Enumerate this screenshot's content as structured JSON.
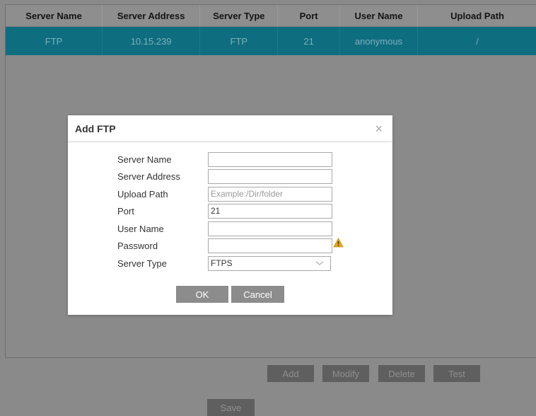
{
  "table": {
    "headers": [
      "Server Name",
      "Server Address",
      "Server Type",
      "Port",
      "User Name",
      "Upload Path"
    ],
    "rows": [
      [
        "FTP",
        "10.15.239",
        "FTP",
        "21",
        "anonymous",
        "/"
      ]
    ]
  },
  "actions": {
    "add": "Add",
    "modify": "Modify",
    "delete": "Delete",
    "test": "Test",
    "save": "Save"
  },
  "dialog": {
    "title": "Add FTP",
    "close_icon": "close-icon",
    "fields": {
      "server_name": {
        "label": "Server Name",
        "value": ""
      },
      "server_address": {
        "label": "Server Address",
        "value": ""
      },
      "upload_path": {
        "label": "Upload Path",
        "value": "",
        "placeholder": "Example:/Dir/folder"
      },
      "port": {
        "label": "Port",
        "value": "21"
      },
      "user_name": {
        "label": "User Name",
        "value": ""
      },
      "password": {
        "label": "Password",
        "value": "",
        "warning_icon": "warning-icon"
      },
      "server_type": {
        "label": "Server Type",
        "value": "FTPS"
      }
    },
    "ok": "OK",
    "cancel": "Cancel"
  },
  "colors": {
    "selected_row": "#0f6d80",
    "overlay": "#8a8a8a",
    "warning": "#e6a817"
  }
}
